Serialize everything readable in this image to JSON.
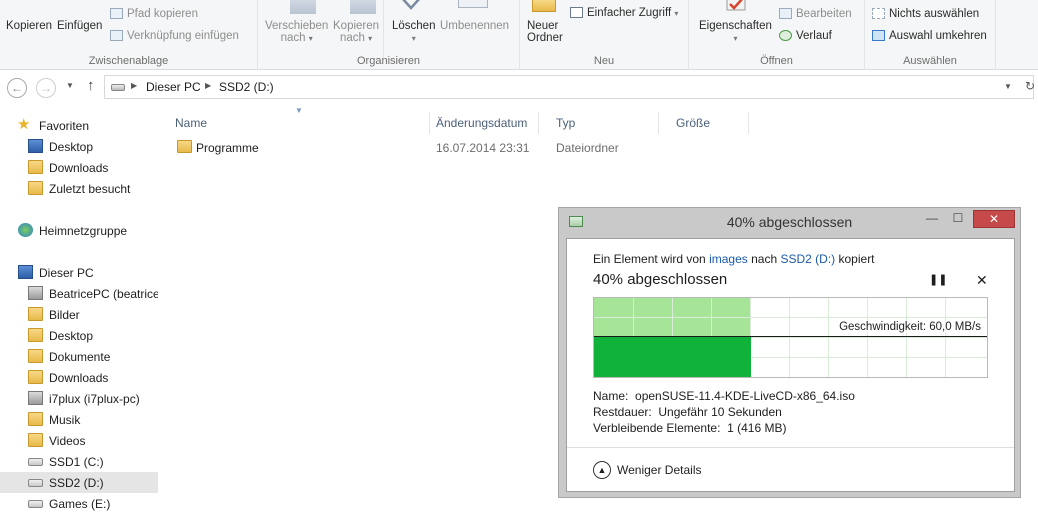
{
  "ribbon": {
    "clipboard": {
      "label": "Zwischenablage",
      "copy": "Kopieren",
      "paste": "Einfügen",
      "copy_path": "Pfad kopieren",
      "paste_shortcut": "Verknüpfung einfügen"
    },
    "organize": {
      "label": "Organisieren",
      "move_to_line1": "Verschieben",
      "move_to_line2": "nach",
      "copy_to_line1": "Kopieren",
      "copy_to_line2": "nach",
      "delete": "Löschen",
      "rename": "Umbenennen"
    },
    "new": {
      "label": "Neu",
      "new_folder_line1": "Neuer",
      "new_folder_line2": "Ordner",
      "easy_access": "Einfacher Zugriff"
    },
    "open": {
      "label": "Öffnen",
      "properties": "Eigenschaften",
      "edit": "Bearbeiten",
      "history": "Verlauf"
    },
    "select": {
      "label": "Auswählen",
      "select_none": "Nichts auswählen",
      "invert_selection": "Auswahl umkehren"
    }
  },
  "address": {
    "crumbs": [
      "Dieser PC",
      "SSD2 (D:)"
    ]
  },
  "nav": {
    "favorites": "Favoriten",
    "fav_items": [
      "Desktop",
      "Downloads",
      "Zuletzt besucht"
    ],
    "homegroup": "Heimnetzgruppe",
    "this_pc": "Dieser PC",
    "pc_items": [
      "BeatricePC (beatrice",
      "Bilder",
      "Desktop",
      "Dokumente",
      "Downloads",
      "i7plux (i7plux-pc)",
      "Musik",
      "Videos",
      "SSD1 (C:)",
      "SSD2 (D:)",
      "Games (E:)"
    ]
  },
  "filelist": {
    "columns": [
      "Name",
      "Änderungsdatum",
      "Typ",
      "Größe"
    ],
    "rows": [
      {
        "name": "Programme",
        "date": "16.07.2014 23:31",
        "type": "Dateiordner",
        "size": ""
      }
    ]
  },
  "dialog": {
    "title": "40% abgeschlossen",
    "status_prefix": "Ein Element wird von",
    "status_source": "images",
    "status_middle": "nach",
    "status_target": "SSD2 (D:)",
    "status_suffix": "kopiert",
    "percent_text": "40% abgeschlossen",
    "progress_fraction": 0.4,
    "speed_label": "Geschwindigkeit: 60,0 MB/s",
    "name_label": "Name:",
    "name_value": "openSUSE-11.4-KDE-LiveCD-x86_64.iso",
    "remaining_label": "Restdauer:",
    "remaining_value": "Ungefähr 10 Sekunden",
    "items_label": "Verbleibende Elemente:",
    "items_value": "1 (416 MB)",
    "less_details": "Weniger Details",
    "colors": {
      "progress": "#a6e597",
      "speed": "#10b23a",
      "close": "#c74a4a",
      "link": "#1a5aa8"
    }
  }
}
